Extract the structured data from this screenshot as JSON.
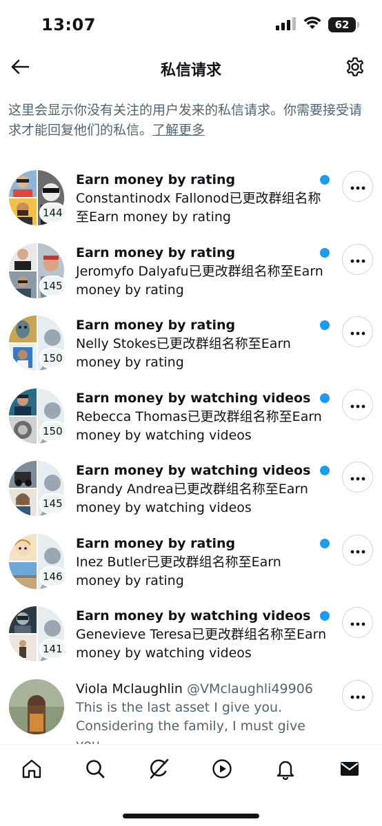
{
  "status_bar": {
    "time": "13:07",
    "battery": "62"
  },
  "header": {
    "title": "私信请求"
  },
  "info": {
    "text": "这里会显示你没有关注的用户发来的私信请求。你需要接受请求才能回复他们的私信。",
    "link": "了解更多"
  },
  "requests": [
    {
      "title": "Earn money by rating",
      "message": "Constantinodx Fallonod已更改群组名称至Earn money by rating",
      "count": "144"
    },
    {
      "title": "Earn money by rating",
      "message": "Jeromyfo Dalyafu已更改群组名称至Earn money by rating",
      "count": "145"
    },
    {
      "title": "Earn money by rating",
      "message": "Nelly Stokes已更改群组名称至Earn money by rating",
      "count": "150"
    },
    {
      "title": "Earn money by watching videos",
      "message": "Rebecca Thomas已更改群组名称至Earn money by watching videos",
      "count": "150"
    },
    {
      "title": "Earn money by watching videos",
      "message": "Brandy Andrea已更改群组名称至Earn money by watching videos",
      "count": "145"
    },
    {
      "title": "Earn money by rating",
      "message": "Inez Butler已更改群组名称至Earn money by rating",
      "count": "146"
    },
    {
      "title": "Earn money by watching videos",
      "message": "Genevieve Teresa已更改群组名称至Earn money by watching videos",
      "count": "141"
    }
  ],
  "last_request": {
    "name": "Viola Mclaughlin",
    "handle": "@VMclaughli49906",
    "preview": "This is the last asset I give you. Considering the family, I must give you"
  },
  "nav": [
    "home-icon",
    "search-icon",
    "grok-icon",
    "video-icon",
    "notifications-icon",
    "messages-icon"
  ],
  "colors": {
    "accent": "#1d9bf0",
    "text": "#0f1419",
    "secondary": "#536471"
  }
}
